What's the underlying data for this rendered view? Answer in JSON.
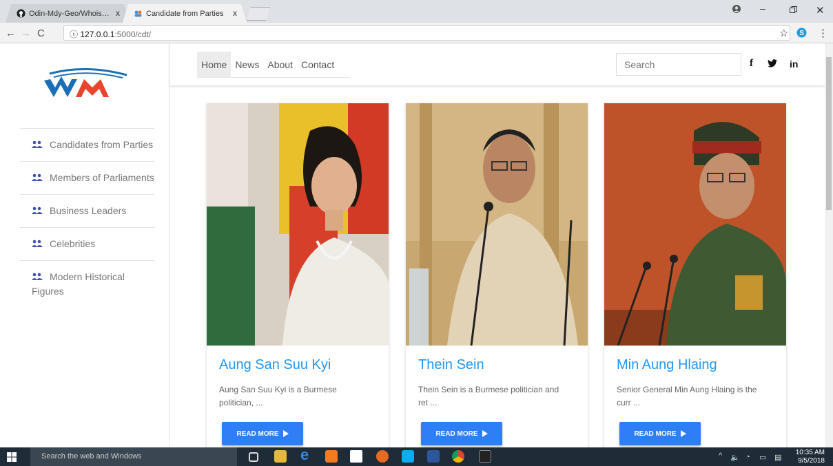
{
  "browser": {
    "tabs": [
      {
        "label": "Odin-Mdy-Geo/WhoisWhoin",
        "icon": "github-icon"
      },
      {
        "label": "Candidate from Parties",
        "icon": "site-favicon"
      }
    ],
    "tab_close": "x",
    "url_host": "127.0.0.1",
    "url_rest": ":5000/cdt/",
    "url_prefix": "ⓘ"
  },
  "sidebar": {
    "logo_alt": "WM logo",
    "items": [
      {
        "label": "Candidates from Parties"
      },
      {
        "label": "Members of Parliaments"
      },
      {
        "label": "Business Leaders"
      },
      {
        "label": "Celebrities"
      },
      {
        "label": "Modern Historical Figures"
      }
    ]
  },
  "nav": {
    "menu": [
      "Home",
      "News",
      "About",
      "Contact"
    ],
    "search_placeholder": "Search",
    "social": [
      "f",
      "in"
    ]
  },
  "cards": [
    {
      "name": "Aung San Suu Kyi",
      "desc": "Aung San Suu Kyi is a Burmese politician, ...",
      "button": "READ MORE"
    },
    {
      "name": "Thein Sein",
      "desc": "Thein Sein is a Burmese politician and ret ...",
      "button": "READ MORE"
    },
    {
      "name": "Min Aung Hlaing",
      "desc": "Senior General Min Aung Hlaing is the curr ...",
      "button": "READ MORE"
    }
  ],
  "taskbar": {
    "search_placeholder": "Search the web and Windows",
    "time": "10:35 AM",
    "date": "9/5/2018"
  },
  "colors": {
    "accent": "#2196f3",
    "button": "#2d7ef7",
    "taskbar": "#1f2b37"
  }
}
